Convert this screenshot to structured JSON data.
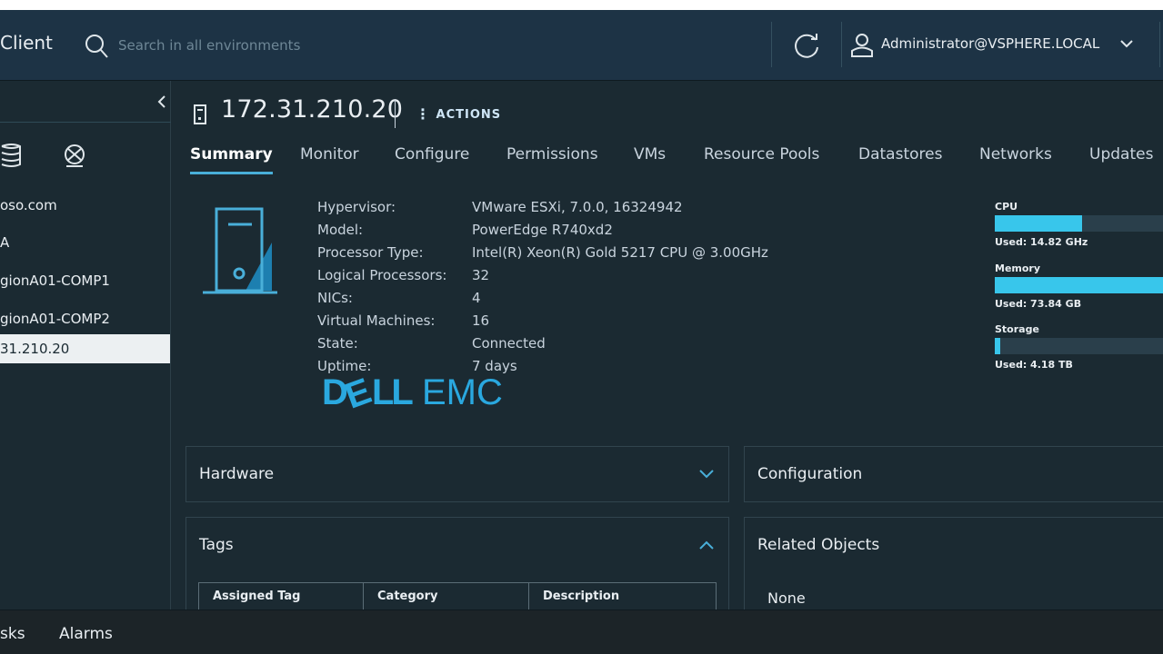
{
  "header": {
    "brand": "Client",
    "search_placeholder": "Search in all environments",
    "user": "Administrator@VSPHERE.LOCAL"
  },
  "sidebar": {
    "items": [
      {
        "label": "oso.com"
      },
      {
        "label": "A"
      },
      {
        "label": "gionA01-COMP1"
      },
      {
        "label": "gionA01-COMP2"
      },
      {
        "label": "31.210.20"
      }
    ]
  },
  "host": {
    "title": "172.31.210.20",
    "actions_label": "ACTIONS"
  },
  "tabs": [
    {
      "label": "Summary"
    },
    {
      "label": "Monitor"
    },
    {
      "label": "Configure"
    },
    {
      "label": "Permissions"
    },
    {
      "label": "VMs"
    },
    {
      "label": "Resource Pools"
    },
    {
      "label": "Datastores"
    },
    {
      "label": "Networks"
    },
    {
      "label": "Updates"
    }
  ],
  "summary": {
    "rows": [
      {
        "label": "Hypervisor:",
        "value": "VMware ESXi, 7.0.0, 16324942"
      },
      {
        "label": "Model:",
        "value": "PowerEdge R740xd2"
      },
      {
        "label": "Processor Type:",
        "value": "Intel(R) Xeon(R) Gold 5217 CPU @ 3.00GHz"
      },
      {
        "label": "Logical Processors:",
        "value": "32"
      },
      {
        "label": "NICs:",
        "value": "4"
      },
      {
        "label": "Virtual Machines:",
        "value": "16"
      },
      {
        "label": "State:",
        "value": "Connected"
      },
      {
        "label": "Uptime:",
        "value": "7 days"
      }
    ],
    "vendor_logo": "DELL EMC"
  },
  "resources": {
    "cpu": {
      "label": "CPU",
      "used": "Used: 14.82 GHz",
      "fill_fraction": 0.52
    },
    "memory": {
      "label": "Memory",
      "used": "Used: 73.84 GB",
      "fill_fraction": 1.0
    },
    "storage": {
      "label": "Storage",
      "used": "Used: 4.18 TB",
      "fill_fraction": 0.03
    },
    "bar_color": "#38c6eb"
  },
  "cards": {
    "hardware": "Hardware",
    "configuration": "Configuration",
    "tags": "Tags",
    "related": "Related Objects",
    "related_value": "None"
  },
  "tags_table": {
    "columns": [
      "Assigned Tag",
      "Category",
      "Description"
    ]
  },
  "bottom": {
    "tasks": "sks",
    "alarms": "Alarms"
  },
  "colors": {
    "accent": "#49afd9",
    "header_bg": "#1d3345",
    "page_bg": "#1b2a32"
  }
}
